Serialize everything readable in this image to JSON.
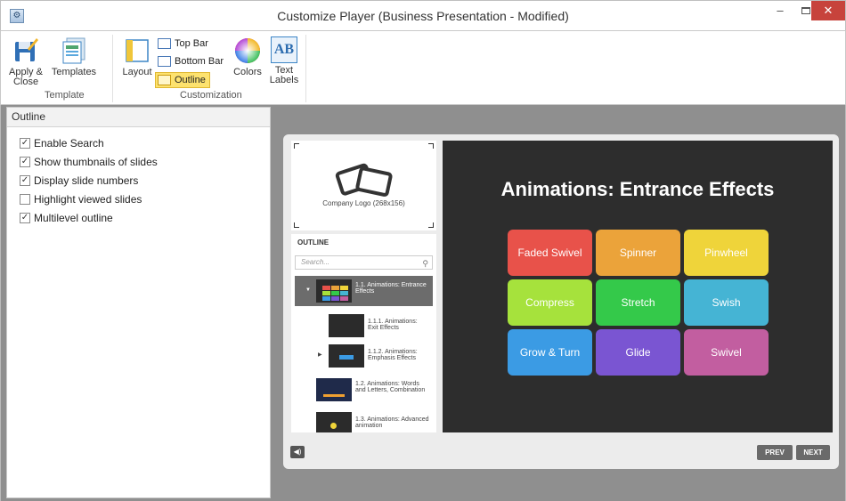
{
  "window": {
    "title": "Customize Player (Business Presentation - Modified)",
    "controls": {
      "minimize": "–",
      "close": "✕"
    }
  },
  "ribbon": {
    "template_group": {
      "label": "Template",
      "apply_close": "Apply & Close",
      "templates": "Templates"
    },
    "customization_group": {
      "label": "Customization",
      "layout": "Layout",
      "top_bar": "Top Bar",
      "bottom_bar": "Bottom Bar",
      "outline": "Outline",
      "colors": "Colors",
      "text_labels": "Text Labels"
    },
    "icon_glyphs": {
      "text_labels": "AB"
    }
  },
  "left_panel": {
    "title": "Outline",
    "options": [
      {
        "label": "Enable Search",
        "checked": true
      },
      {
        "label": "Show thumbnails of slides",
        "checked": true
      },
      {
        "label": "Display slide numbers",
        "checked": true
      },
      {
        "label": "Highlight viewed slides",
        "checked": false
      },
      {
        "label": "Multilevel outline",
        "checked": true
      }
    ]
  },
  "player": {
    "logo_text": "Company Logo (268x156)",
    "outline_title": "OUTLINE",
    "search_placeholder": "Search...",
    "outline_items": [
      {
        "text": "1.1. Animations: Entrance Effects",
        "selected": true
      },
      {
        "text": "1.1.1. Animations: Exit Effects",
        "selected": false
      },
      {
        "text": "1.1.2. Animations: Emphasis Effects",
        "selected": false
      },
      {
        "text": "1.2. Animations: Words and Letters, Combination",
        "selected": false
      },
      {
        "text": "1.3. Animations: Advanced animation",
        "selected": false
      }
    ],
    "slide": {
      "title": "Animations: Entrance Effects",
      "tiles": [
        {
          "label": "Faded Swivel",
          "color": "#e8524a"
        },
        {
          "label": "Spinner",
          "color": "#eba33a"
        },
        {
          "label": "Pinwheel",
          "color": "#efd43a"
        },
        {
          "label": "Compress",
          "color": "#a6e23c"
        },
        {
          "label": "Stretch",
          "color": "#34c94a"
        },
        {
          "label": "Swish",
          "color": "#45b4d4"
        },
        {
          "label": "Grow & Turn",
          "color": "#3b9be4"
        },
        {
          "label": "Glide",
          "color": "#7a55d2"
        },
        {
          "label": "Swivel",
          "color": "#c25ea0"
        }
      ]
    },
    "nav": {
      "prev": "PREV",
      "next": "NEXT"
    }
  },
  "colors": {
    "active_button": "#fde26e",
    "close_button": "#c7433c",
    "preview_background": "#8f8f8f",
    "slide_background": "#2d2d2d"
  }
}
